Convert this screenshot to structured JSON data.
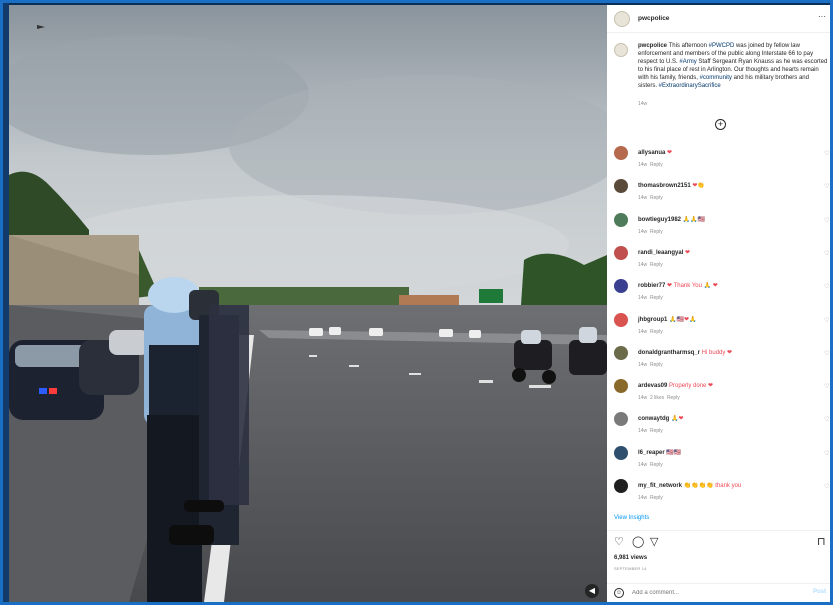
{
  "header": {
    "username": "pwcpolice",
    "more_label": "···"
  },
  "caption": {
    "username": "pwcpolice",
    "text_1": " This afternoon ",
    "tag_1": "#PWCPD",
    "text_2": " was joined by fellow law enforcement and members of the public along Interstate 66 to pay respect to U.S. ",
    "tag_2": "#Army",
    "text_3": " Staff Sergeant Ryan Knauss as he was escorted to his final place of rest in Arlington. Our thoughts and hearts remain with his family, friends, ",
    "tag_3": "#community",
    "text_4": " and his military brothers and sisters. ",
    "tag_4": "#ExtraordinarySacrifice",
    "time": "14w"
  },
  "load_more_icon": "plus-circle-icon",
  "comments": [
    {
      "user": "allysanua",
      "text": " ❤",
      "time": "14w",
      "likes": "",
      "reply": "Reply",
      "color": "#b56a4e"
    },
    {
      "user": "thomasbrown2151",
      "text": " ❤👏",
      "time": "14w",
      "likes": "",
      "reply": "Reply",
      "color": "#5a4a3a"
    },
    {
      "user": "bowtieguy1982",
      "text": " 🙏🙏🇺🇸",
      "time": "14w",
      "likes": "",
      "reply": "Reply",
      "color": "#4e7c5a"
    },
    {
      "user": "randi_leaangyal",
      "text": " ❤",
      "time": "14w",
      "likes": "",
      "reply": "Reply",
      "color": "#c0504d"
    },
    {
      "user": "robbier77",
      "text": " ❤ Thank You 🙏 ❤",
      "time": "14w",
      "likes": "",
      "reply": "Reply",
      "color": "#3b3f8f"
    },
    {
      "user": "jhbgroup1",
      "text": " 🙏🇺🇸❤🙏",
      "time": "14w",
      "likes": "",
      "reply": "Reply",
      "color": "#d9534f"
    },
    {
      "user": "donaldgrantharmsq_r",
      "text": " Hi buddy ❤",
      "time": "14w",
      "likes": "",
      "reply": "Reply",
      "color": "#6b6b4a"
    },
    {
      "user": "ardevas09",
      "text": " Properly done ❤",
      "time": "14w",
      "likes": "2 likes",
      "reply": "Reply",
      "color": "#8a6a2a"
    },
    {
      "user": "conwaytdg",
      "text": " 🙏❤",
      "time": "14w",
      "likes": "",
      "reply": "Reply",
      "color": "#7a7a7a"
    },
    {
      "user": "l6_reaper",
      "text": " 🇺🇸🇺🇸",
      "time": "14w",
      "likes": "",
      "reply": "Reply",
      "color": "#2f4f6f"
    },
    {
      "user": "my_fit_network",
      "text": " 👏👏👏👏 thank you",
      "time": "14w",
      "likes": "",
      "reply": "Reply",
      "color": "#1f1f1f"
    }
  ],
  "view_insights": "View Insights",
  "actions": {
    "like_icon": "heart-icon",
    "comment_icon": "comment-icon",
    "share_icon": "send-icon",
    "save_icon": "bookmark-icon"
  },
  "views": "6,981 views",
  "date": "SEPTEMBER 14",
  "add_comment": {
    "placeholder": "Add a comment...",
    "post": "Post"
  }
}
